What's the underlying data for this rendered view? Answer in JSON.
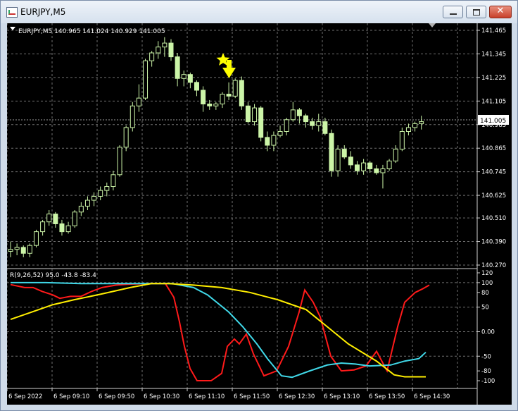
{
  "window": {
    "title": "EURJPY,M5",
    "close_glyph": "✕"
  },
  "price_panel": {
    "info": "EURJPY,M5  140.965 141.024 140.929 141.005",
    "current_price": "141.005",
    "ticks": [
      "141.465",
      "141.345",
      "141.225",
      "141.105",
      "140.985",
      "140.865",
      "140.745",
      "140.625",
      "140.510",
      "140.390",
      "140.270"
    ]
  },
  "indicator_panel": {
    "label": "R(9,26,52) 95.0 -43.8 -83.4",
    "ticks": [
      "120",
      "100",
      "80",
      "50",
      "0.00",
      "-50",
      "-80",
      "-100"
    ]
  },
  "time_axis": {
    "labels": [
      "6 Sep 2022",
      "6 Sep 09:10",
      "6 Sep 09:50",
      "6 Sep 10:30",
      "6 Sep 11:10",
      "6 Sep 11:50",
      "6 Sep 12:30",
      "6 Sep 13:10",
      "6 Sep 13:50",
      "6 Sep 14:30"
    ]
  },
  "colors": {
    "background": "#000000",
    "grid": "#707070",
    "candles": "#ccf5a8",
    "axis_text": "#ffffff",
    "marker": "#ffff00",
    "line_red": "#ff1a1a",
    "line_cyan": "#40d8e8",
    "line_yellow": "#ffee00"
  },
  "icons": {
    "signal_marker": "star-icon",
    "signal_arrow": "arrow-down-icon"
  },
  "chart_data": [
    {
      "type": "candlestick",
      "symbol": "EURJPY",
      "timeframe": "M5",
      "ylim": [
        140.27,
        141.465
      ],
      "grid": true,
      "bars": [
        [
          140.34,
          140.39,
          140.31,
          140.35
        ],
        [
          140.35,
          140.38,
          140.32,
          140.36
        ],
        [
          140.36,
          140.37,
          140.31,
          140.33
        ],
        [
          140.33,
          140.38,
          140.31,
          140.37
        ],
        [
          140.37,
          140.45,
          140.36,
          140.44
        ],
        [
          140.44,
          140.5,
          140.42,
          140.49
        ],
        [
          140.49,
          140.55,
          140.47,
          140.53
        ],
        [
          140.53,
          140.54,
          140.46,
          140.48
        ],
        [
          140.48,
          140.5,
          140.42,
          140.44
        ],
        [
          140.44,
          140.49,
          140.43,
          140.47
        ],
        [
          140.47,
          140.55,
          140.46,
          140.54
        ],
        [
          140.54,
          140.59,
          140.52,
          140.57
        ],
        [
          140.57,
          140.62,
          140.55,
          140.6
        ],
        [
          140.6,
          140.64,
          140.57,
          140.62
        ],
        [
          140.62,
          140.67,
          140.6,
          140.65
        ],
        [
          140.65,
          140.69,
          140.62,
          140.67
        ],
        [
          140.67,
          140.75,
          140.65,
          140.73
        ],
        [
          140.73,
          140.88,
          140.72,
          140.87
        ],
        [
          140.87,
          140.98,
          140.85,
          140.97
        ],
        [
          140.97,
          141.1,
          140.95,
          141.08
        ],
        [
          141.08,
          141.19,
          141.05,
          141.12
        ],
        [
          141.12,
          141.32,
          141.11,
          141.31
        ],
        [
          141.31,
          141.36,
          141.28,
          141.35
        ],
        [
          141.35,
          141.41,
          141.32,
          141.38
        ],
        [
          141.38,
          141.43,
          141.33,
          141.4
        ],
        [
          141.4,
          141.42,
          141.31,
          141.33
        ],
        [
          141.33,
          141.35,
          141.18,
          141.22
        ],
        [
          141.22,
          141.26,
          141.18,
          141.24
        ],
        [
          141.24,
          141.25,
          141.17,
          141.2
        ],
        [
          141.2,
          141.21,
          141.13,
          141.16
        ],
        [
          141.16,
          141.18,
          141.05,
          141.09
        ],
        [
          141.09,
          141.11,
          141.06,
          141.08
        ],
        [
          141.08,
          141.1,
          141.06,
          141.09
        ],
        [
          141.09,
          141.15,
          141.07,
          141.14
        ],
        [
          141.14,
          141.2,
          141.11,
          141.13
        ],
        [
          141.13,
          141.22,
          141.12,
          141.21
        ],
        [
          141.21,
          141.23,
          141.06,
          141.08
        ],
        [
          141.08,
          141.1,
          140.99,
          141.0
        ],
        [
          141.0,
          141.09,
          140.98,
          141.07
        ],
        [
          141.07,
          141.08,
          140.9,
          140.92
        ],
        [
          140.92,
          140.95,
          140.85,
          140.88
        ],
        [
          140.88,
          140.95,
          140.85,
          140.93
        ],
        [
          140.93,
          140.98,
          140.92,
          140.95
        ],
        [
          140.95,
          141.02,
          140.93,
          141.01
        ],
        [
          141.01,
          141.1,
          141.0,
          141.06
        ],
        [
          141.06,
          141.07,
          140.99,
          141.03
        ],
        [
          141.03,
          141.04,
          140.97,
          141.0
        ],
        [
          141.0,
          141.02,
          140.96,
          140.98
        ],
        [
          140.98,
          141.04,
          140.95,
          141.0
        ],
        [
          141.0,
          141.02,
          140.93,
          140.94
        ],
        [
          140.94,
          140.96,
          140.72,
          140.75
        ],
        [
          140.75,
          140.88,
          140.72,
          140.86
        ],
        [
          140.86,
          140.88,
          140.81,
          140.82
        ],
        [
          140.82,
          140.85,
          140.76,
          140.78
        ],
        [
          140.78,
          140.8,
          140.73,
          140.75
        ],
        [
          140.75,
          140.81,
          140.73,
          140.79
        ],
        [
          140.79,
          140.8,
          140.74,
          140.76
        ],
        [
          140.76,
          140.78,
          140.73,
          140.74
        ],
        [
          140.74,
          140.78,
          140.66,
          140.76
        ],
        [
          140.76,
          140.81,
          140.75,
          140.8
        ],
        [
          140.8,
          140.88,
          140.79,
          140.86
        ],
        [
          140.86,
          140.97,
          140.85,
          140.95
        ],
        [
          140.95,
          140.99,
          140.93,
          140.97
        ],
        [
          140.97,
          141.0,
          140.95,
          140.99
        ],
        [
          140.99,
          141.03,
          140.96,
          141.0
        ]
      ]
    },
    {
      "type": "line",
      "ylim": [
        -110,
        120
      ],
      "series": [
        {
          "color": "#ff1a1a",
          "values": [
            [
              0,
              96
            ],
            [
              20,
              90
            ],
            [
              32,
              90
            ],
            [
              45,
              82
            ],
            [
              60,
              75
            ],
            [
              70,
              68
            ],
            [
              85,
              72
            ],
            [
              100,
              72
            ],
            [
              115,
              82
            ],
            [
              130,
              90
            ],
            [
              150,
              95
            ],
            [
              170,
              97
            ],
            [
              200,
              98
            ],
            [
              220,
              98
            ],
            [
              232,
              70
            ],
            [
              240,
              20
            ],
            [
              247,
              -30
            ],
            [
              255,
              -75
            ],
            [
              265,
              -100
            ],
            [
              285,
              -100
            ],
            [
              300,
              -85
            ],
            [
              308,
              -30
            ],
            [
              318,
              -15
            ],
            [
              325,
              -25
            ],
            [
              335,
              -5
            ],
            [
              345,
              -45
            ],
            [
              360,
              -90
            ],
            [
              378,
              -80
            ],
            [
              395,
              -30
            ],
            [
              410,
              40
            ],
            [
              418,
              85
            ],
            [
              430,
              60
            ],
            [
              440,
              30
            ],
            [
              455,
              -50
            ],
            [
              470,
              -80
            ],
            [
              488,
              -78
            ],
            [
              505,
              -70
            ],
            [
              520,
              -40
            ],
            [
              535,
              -80
            ],
            [
              550,
              10
            ],
            [
              560,
              60
            ],
            [
              575,
              80
            ],
            [
              585,
              87
            ],
            [
              595,
              95
            ]
          ]
        },
        {
          "color": "#40d8e8",
          "values": [
            [
              0,
              100
            ],
            [
              50,
              100
            ],
            [
              100,
              98
            ],
            [
              150,
              98
            ],
            [
              200,
              98
            ],
            [
              230,
              98
            ],
            [
              260,
              90
            ],
            [
              280,
              75
            ],
            [
              310,
              40
            ],
            [
              330,
              10
            ],
            [
              350,
              -25
            ],
            [
              365,
              -55
            ],
            [
              385,
              -90
            ],
            [
              400,
              -93
            ],
            [
              425,
              -80
            ],
            [
              450,
              -68
            ],
            [
              470,
              -64
            ],
            [
              490,
              -66
            ],
            [
              510,
              -70
            ],
            [
              540,
              -68
            ],
            [
              560,
              -60
            ],
            [
              580,
              -55
            ],
            [
              590,
              -42
            ]
          ]
        },
        {
          "color": "#ffee00",
          "values": [
            [
              0,
              25
            ],
            [
              30,
              40
            ],
            [
              60,
              55
            ],
            [
              90,
              65
            ],
            [
              130,
              77
            ],
            [
              170,
              90
            ],
            [
              200,
              98
            ],
            [
              225,
              98
            ],
            [
              260,
              95
            ],
            [
              300,
              90
            ],
            [
              340,
              80
            ],
            [
              380,
              65
            ],
            [
              420,
              45
            ],
            [
              450,
              10
            ],
            [
              480,
              -25
            ],
            [
              520,
              -60
            ],
            [
              545,
              -88
            ],
            [
              560,
              -92
            ],
            [
              590,
              -92
            ]
          ]
        }
      ]
    }
  ]
}
